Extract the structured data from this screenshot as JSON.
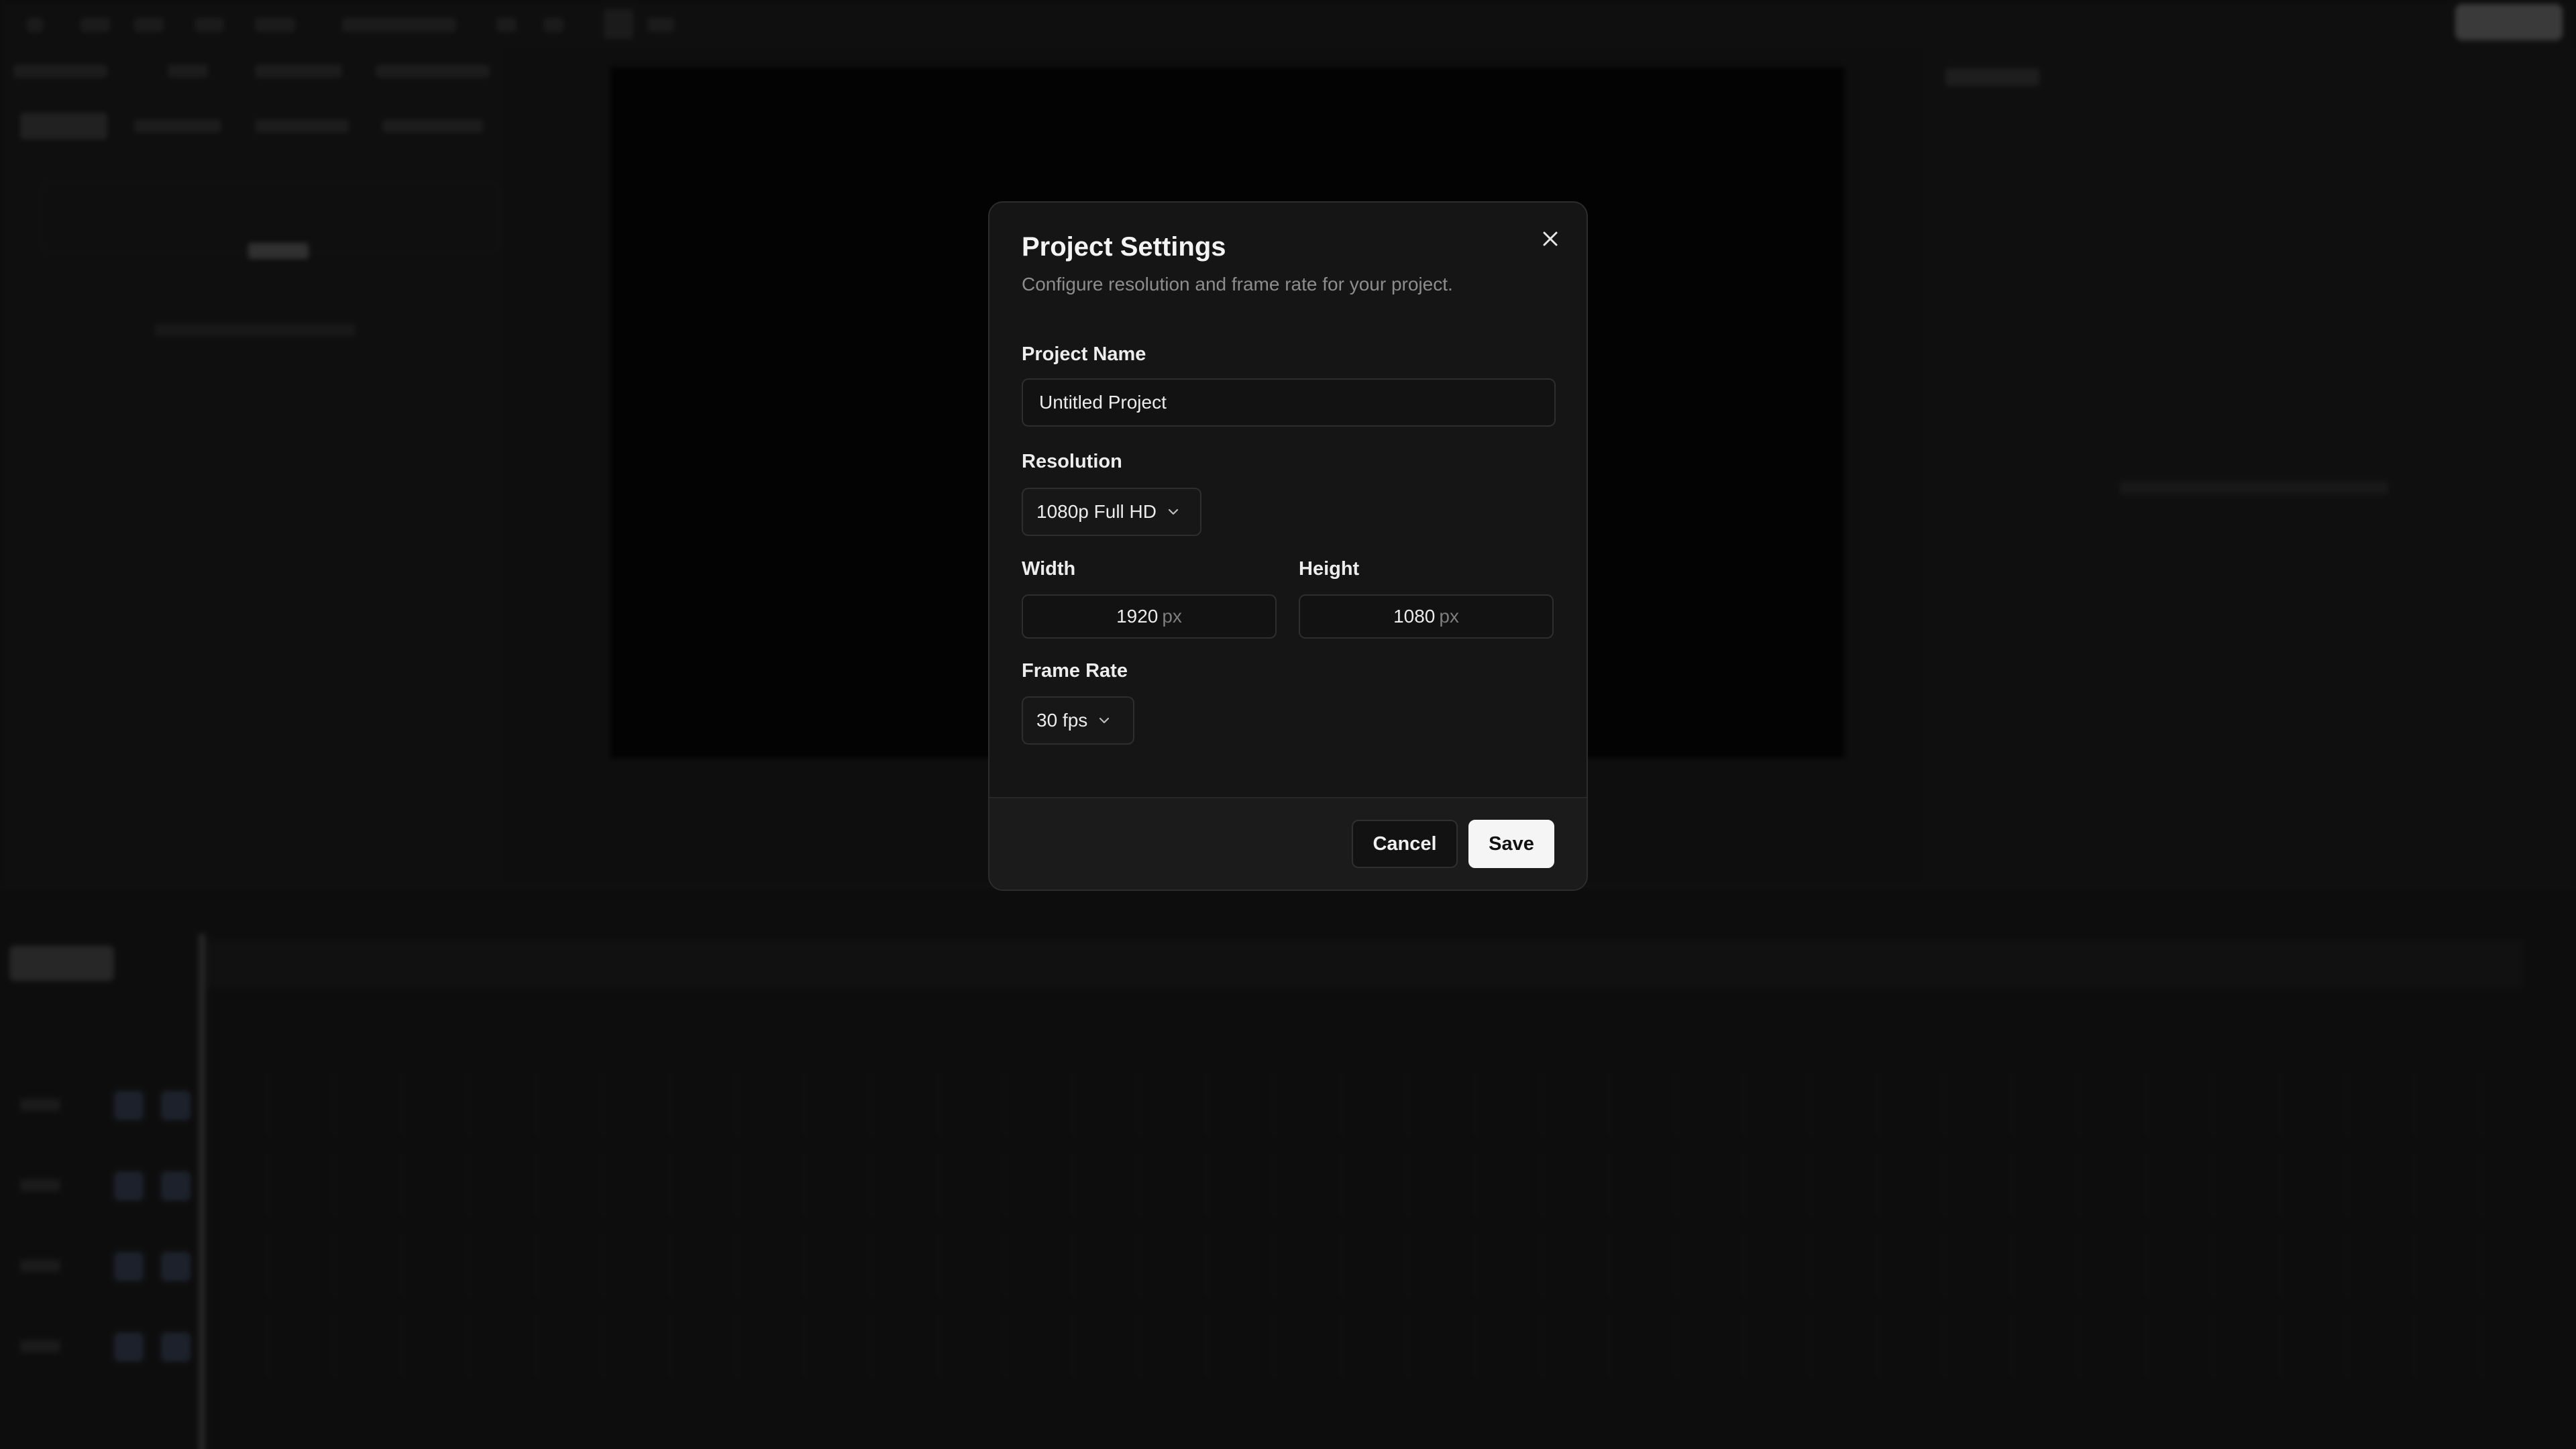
{
  "dialog": {
    "title": "Project Settings",
    "subtitle": "Configure resolution and frame rate for your project.",
    "close_icon": "close-icon",
    "project_name": {
      "label": "Project Name",
      "value": "Untitled Project"
    },
    "resolution": {
      "label": "Resolution",
      "selected": "1080p Full HD",
      "icon": "chevron-down-icon"
    },
    "width": {
      "label": "Width",
      "value": "1920",
      "unit": "px"
    },
    "height": {
      "label": "Height",
      "value": "1080",
      "unit": "px"
    },
    "frame_rate": {
      "label": "Frame Rate",
      "selected": "30 fps",
      "icon": "chevron-down-icon"
    },
    "footer": {
      "cancel_label": "Cancel",
      "save_label": "Save"
    }
  },
  "colors": {
    "dialog_bg": "#151515",
    "footer_bg": "#1b1b1b",
    "save_bg": "#f5f5f5",
    "overlay": "#000000"
  }
}
